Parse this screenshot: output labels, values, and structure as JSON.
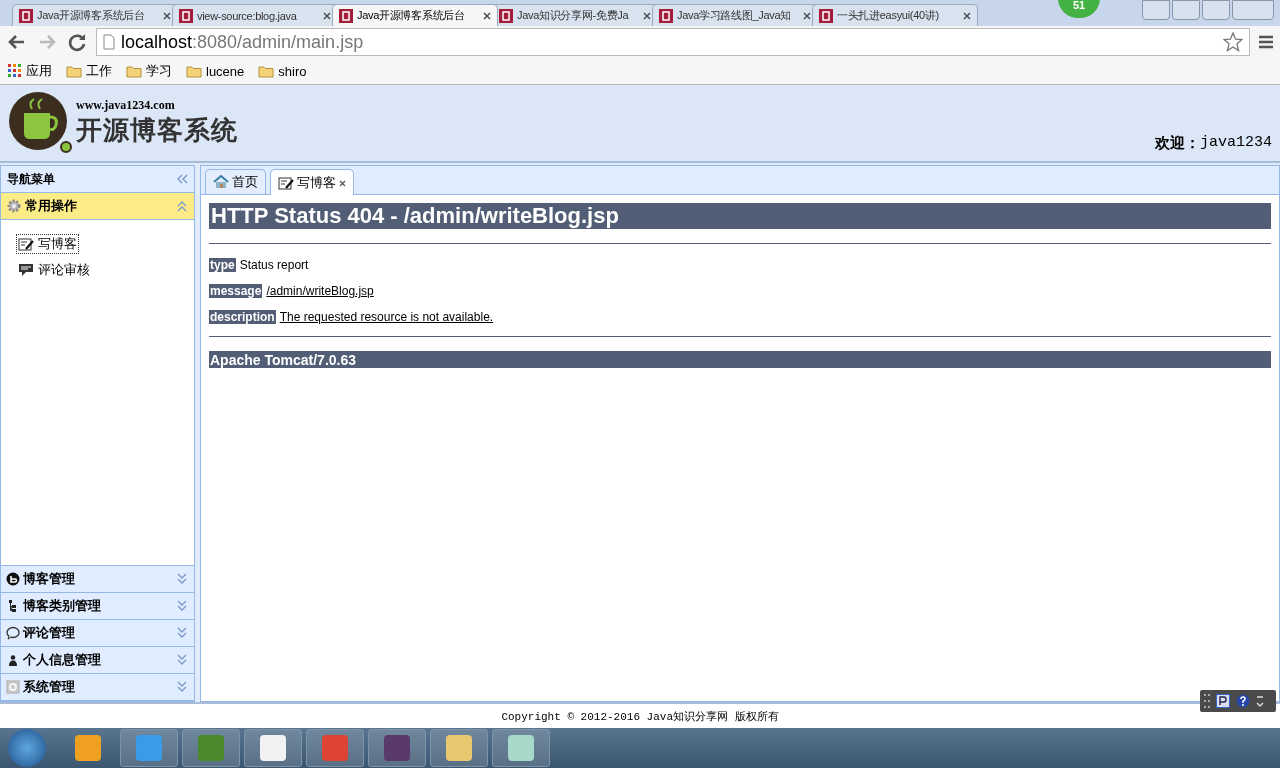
{
  "browser": {
    "tabs": [
      {
        "title": "Java开源博客系统后台",
        "selected": false
      },
      {
        "title": "view-source:blog.java",
        "selected": false
      },
      {
        "title": "Java开源博客系统后台",
        "selected": true
      },
      {
        "title": "Java知识分享网-免费Ja",
        "selected": false
      },
      {
        "title": "Java学习路线图_Java知",
        "selected": false
      },
      {
        "title": "一头扎进easyui(40讲)",
        "selected": false
      }
    ],
    "profile_badge": "51",
    "address": {
      "host": "localhost",
      "path": ":8080/admin/main.jsp"
    },
    "bookmarks": [
      "应用",
      "工作",
      "学习",
      "lucene",
      "shiro"
    ]
  },
  "header": {
    "site_url": "www.java1234.com",
    "site_name": "开源博客系统",
    "welcome_label": "欢迎：",
    "username": "java1234"
  },
  "sidebar": {
    "title": "导航菜单",
    "panels": [
      {
        "title": "常用操作",
        "expanded": true,
        "items": [
          {
            "label": "写博客",
            "selected": true
          },
          {
            "label": "评论审核",
            "selected": false
          }
        ]
      },
      {
        "title": "博客管理",
        "expanded": false
      },
      {
        "title": "博客类别管理",
        "expanded": false
      },
      {
        "title": "评论管理",
        "expanded": false
      },
      {
        "title": "个人信息管理",
        "expanded": false
      },
      {
        "title": "系统管理",
        "expanded": false
      }
    ]
  },
  "content_tabs": [
    {
      "label": "首页",
      "selected": false,
      "closable": false
    },
    {
      "label": "写博客",
      "selected": true,
      "closable": true
    }
  ],
  "error_page": {
    "heading": "HTTP Status 404 - /admin/writeBlog.jsp",
    "fields": [
      {
        "label": "type",
        "value": "Status report",
        "underlined": false
      },
      {
        "label": "message",
        "value": "/admin/writeBlog.jsp",
        "underlined": true
      },
      {
        "label": "description",
        "value": "The requested resource is not available.",
        "underlined": true
      }
    ],
    "server": "Apache Tomcat/7.0.63"
  },
  "footer": "Copyright © 2012-2016 Java知识分享网 版权所有"
}
